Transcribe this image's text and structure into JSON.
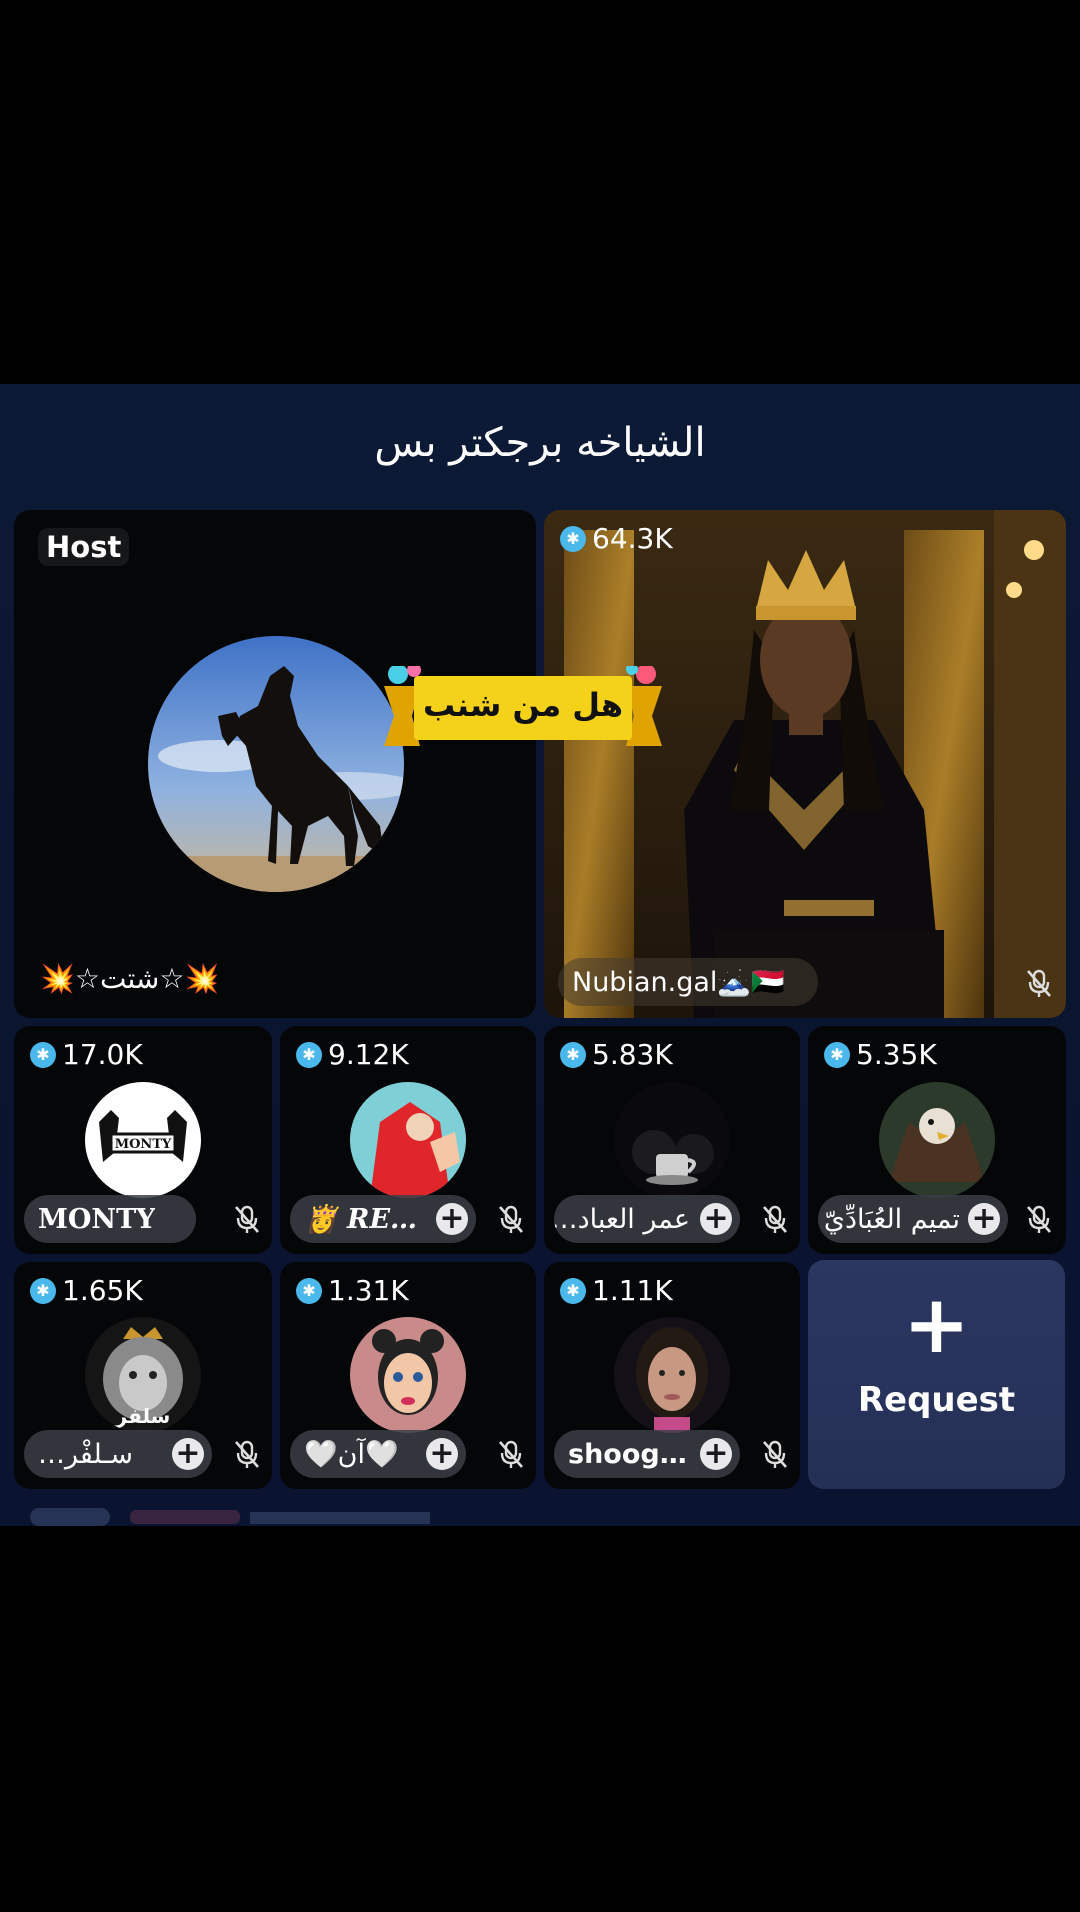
{
  "room": {
    "title": "الشياخه برجكتر بس"
  },
  "host": {
    "label": "Host",
    "name": "💥☆شتت☆💥"
  },
  "banner": {
    "text": "هل من شنب"
  },
  "featured": {
    "score": "64.3K",
    "name": "Nubian.gal🗻🇸🇩"
  },
  "seats": [
    {
      "score": "17.0K",
      "name": "MONTY",
      "avatar_text": "MONTY"
    },
    {
      "score": "9.12K",
      "name": "👸 RE…"
    },
    {
      "score": "5.83K",
      "name": "عمر العباد…"
    },
    {
      "score": "5.35K",
      "name": "تميم العُبَادِّيّ"
    },
    {
      "score": "1.65K",
      "name": "سـلفْر…",
      "avatar_text": "سلفر"
    },
    {
      "score": "1.31K",
      "name": "🤍آن🤍"
    },
    {
      "score": "1.11K",
      "name": "shoog…"
    }
  ],
  "request": {
    "label": "Request",
    "icon": "+"
  },
  "colors": {
    "panel": "#0d1a36",
    "gem": "#4ab8ea",
    "request": "#2b3761",
    "banner": "#f5d21a"
  }
}
